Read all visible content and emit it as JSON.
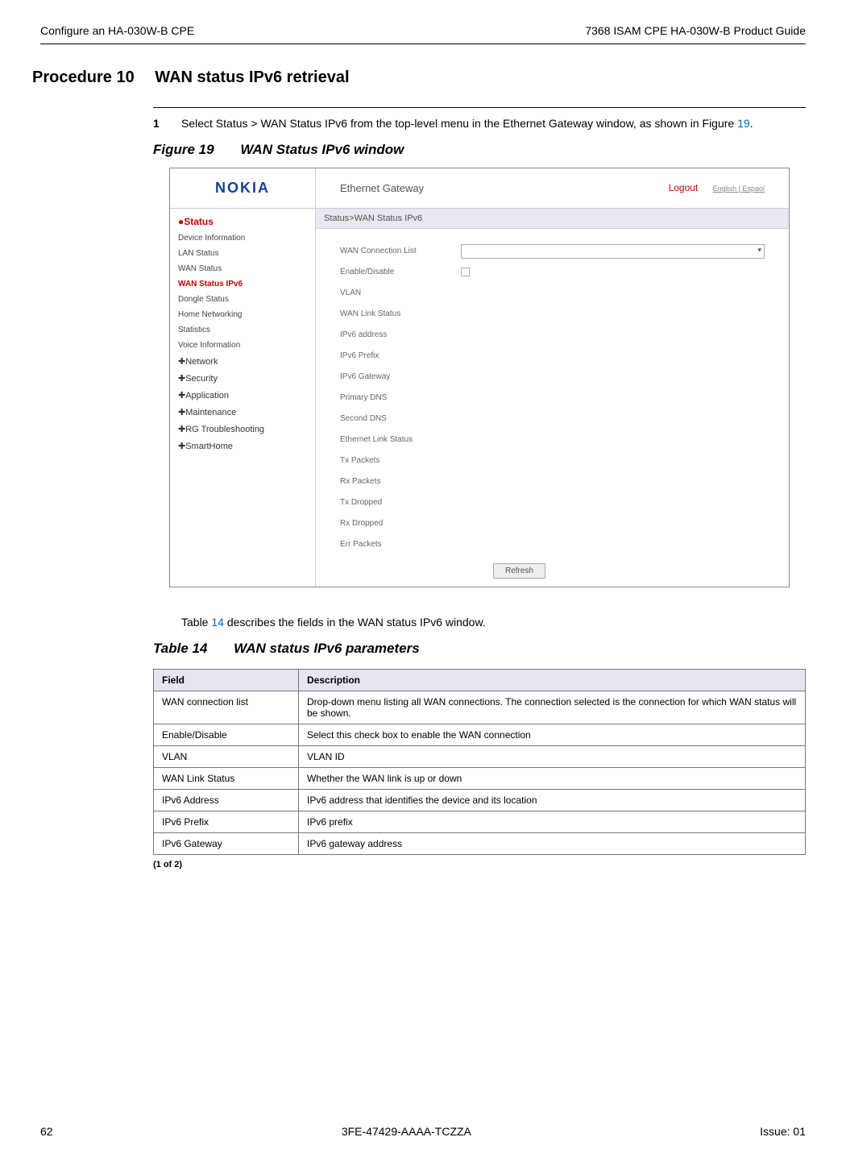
{
  "header": {
    "left": "Configure an HA-030W-B CPE",
    "right": "7368 ISAM CPE HA-030W-B Product Guide"
  },
  "procedure": {
    "label": "Procedure 10",
    "title": "WAN status IPv6 retrieval"
  },
  "step": {
    "number": "1",
    "text_a": "Select Status > WAN Status IPv6 from the top-level menu in the Ethernet Gateway window, as shown in Figure ",
    "link": "19",
    "text_b": "."
  },
  "figure": {
    "label": "Figure 19",
    "title": "WAN Status IPv6 window"
  },
  "screenshot": {
    "logo": "NOKIA",
    "gateway_title": "Ethernet Gateway",
    "logout": "Logout",
    "lang": "English | Espaol",
    "breadcrumb": "Status>WAN Status IPv6",
    "sidebar": {
      "status_heading": "Status",
      "items": [
        "Device Information",
        "LAN Status",
        "WAN Status",
        "WAN Status IPv6",
        "Dongle Status",
        "Home Networking",
        "Statistics",
        "Voice Information"
      ],
      "expandable": [
        "Network",
        "Security",
        "Application",
        "Maintenance",
        "RG Troubleshooting",
        "SmartHome"
      ]
    },
    "fields": {
      "wan_conn_list": "WAN Connection List",
      "enable_disable": "Enable/Disable",
      "vlan": "VLAN",
      "wan_link_status": "WAN Link Status",
      "ipv6_address": "IPv6 address",
      "ipv6_prefix": "IPv6 Prefix",
      "ipv6_gateway": "IPv6 Gateway",
      "primary_dns": "Primary DNS",
      "second_dns": "Second DNS",
      "eth_link_status": "Ethernet Link Status",
      "tx_packets": "Tx Packets",
      "rx_packets": "Rx Packets",
      "tx_dropped": "Tx Dropped",
      "rx_dropped": "Rx Dropped",
      "err_packets": "Err Packets"
    },
    "refresh": "Refresh"
  },
  "table_intro": {
    "text_a": "Table ",
    "link": "14",
    "text_b": " describes the fields in the WAN status IPv6 window."
  },
  "table": {
    "label": "Table 14",
    "title": "WAN status IPv6 parameters",
    "headers": {
      "field": "Field",
      "desc": "Description"
    },
    "rows": [
      {
        "field": "WAN connection list",
        "desc": "Drop-down menu listing all WAN connections. The connection selected is the connection for which WAN status will be shown."
      },
      {
        "field": "Enable/Disable",
        "desc": "Select this check box to enable the WAN connection"
      },
      {
        "field": "VLAN",
        "desc": "VLAN ID"
      },
      {
        "field": "WAN Link Status",
        "desc": "Whether the WAN link is up or down"
      },
      {
        "field": "IPv6 Address",
        "desc": "IPv6 address that identifies the device and its location"
      },
      {
        "field": "IPv6 Prefix",
        "desc": "IPv6 prefix"
      },
      {
        "field": "IPv6 Gateway",
        "desc": "IPv6 gateway address"
      }
    ],
    "page_note": "(1 of 2)"
  },
  "footer": {
    "left": "62",
    "center": "3FE-47429-AAAA-TCZZA",
    "right": "Issue: 01"
  }
}
